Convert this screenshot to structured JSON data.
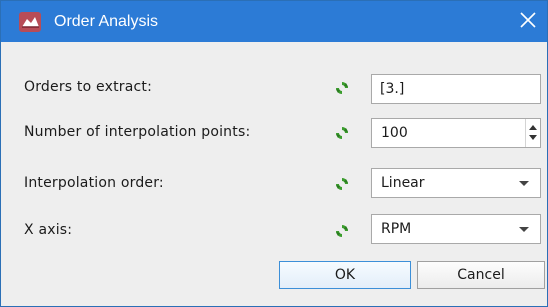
{
  "window": {
    "title": "Order Analysis",
    "accent_color": "#2c7bd6",
    "icon": "app-icon",
    "close_icon": "close-icon"
  },
  "form": {
    "rows": [
      {
        "label": "Orders to extract:",
        "control": "text-input",
        "value": "[3.]"
      },
      {
        "label": "Number of interpolation points:",
        "control": "spinbox",
        "value": "100"
      },
      {
        "label": "Interpolation order:",
        "control": "dropdown",
        "value": "Linear"
      },
      {
        "label": "X axis:",
        "control": "dropdown",
        "value": "RPM"
      }
    ],
    "reset_icon": "reset-default-icon",
    "reset_icon_color": "#3a9d2c"
  },
  "buttons": {
    "ok_label": "OK",
    "cancel_label": "Cancel"
  }
}
